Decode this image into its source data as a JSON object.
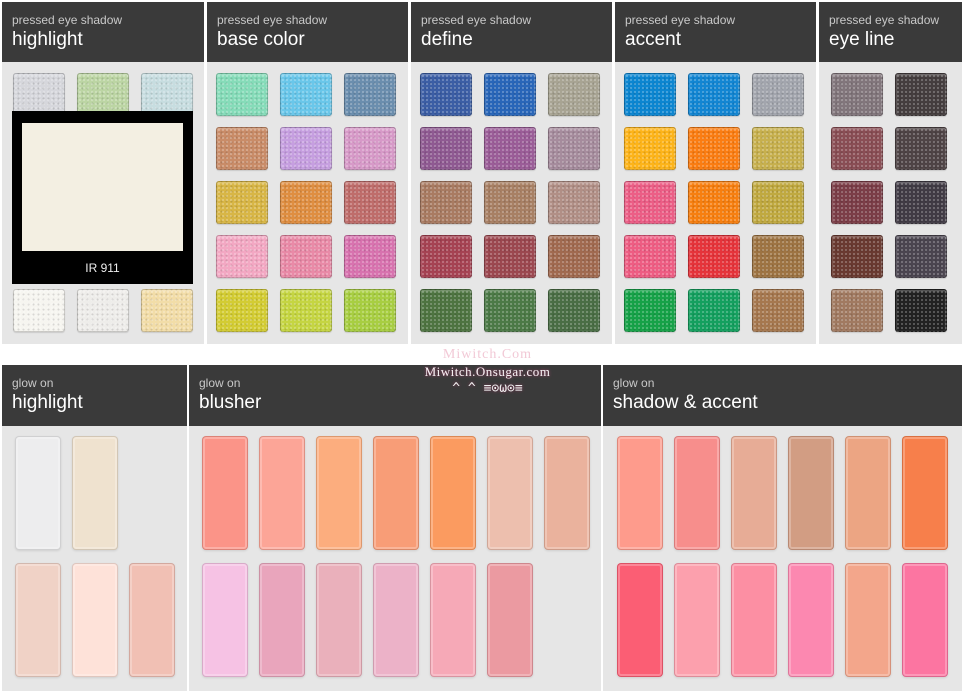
{
  "colors": {
    "header_bg": "#3a3a3a",
    "panel_bg": "#e6e6e6"
  },
  "panels": [
    {
      "sub": "pressed eye shadow",
      "title": "highlight"
    },
    {
      "sub": "pressed eye shadow",
      "title": "base color"
    },
    {
      "sub": "pressed eye shadow",
      "title": "define"
    },
    {
      "sub": "pressed eye shadow",
      "title": "accent"
    },
    {
      "sub": "pressed eye shadow",
      "title": "eye line"
    },
    {
      "sub": "glow on",
      "title": "highlight"
    },
    {
      "sub": "glow on",
      "title": "blusher"
    },
    {
      "sub": "glow on",
      "title": "shadow & accent"
    }
  ],
  "popup": {
    "label": "IR 911",
    "color": "#f3efe2"
  },
  "watermark": {
    "line1": "Miwitch.Com",
    "line2": "Miwitch.Onsugar.com",
    "line3": "^ ^ ≡⊙ω⊙≡"
  },
  "eye": {
    "highlight": [
      "#d6d7dc",
      "#bcd5a4",
      "#c7dde0",
      "#f6f5f0",
      "#eeedea",
      "#f2dda8"
    ],
    "base_color": [
      "#86dcb9",
      "#6ac7ea",
      "#6b8eae",
      "#c98c68",
      "#c69fe0",
      "#d79ac8",
      "#d8b646",
      "#df8e41",
      "#bf6d6b",
      "#f3a8c3",
      "#e98aa7",
      "#d873af",
      "#d3cc33",
      "#c5d542",
      "#a8ce42"
    ],
    "define": [
      "#3c5ea5",
      "#2966b9",
      "#a8a493",
      "#8f5a92",
      "#9b5d98",
      "#a68c9d",
      "#a97b62",
      "#a88064",
      "#b18f86",
      "#a64353",
      "#9c4850",
      "#a16a50",
      "#4e7441",
      "#4c7a47",
      "#4a6e45"
    ],
    "accent": [
      "#0c86d1",
      "#1286d3",
      "#a2a5ad",
      "#fdb41a",
      "#fb7d12",
      "#c7b04e",
      "#ec5e86",
      "#f77f10",
      "#c0a940",
      "#ee5d83",
      "#e6343b",
      "#9e7443",
      "#16a248",
      "#14a05f",
      "#a6784f"
    ],
    "eye_line": [
      "#82767c",
      "#453e3f",
      "#8a4e55",
      "#4f4446",
      "#7c3e48",
      "#413b45",
      "#6a3a31",
      "#4b4550",
      "#a17a61",
      "#222222"
    ]
  },
  "glow": {
    "highlight": [
      "#ededee",
      "#efe2cf",
      "#f0d2c6",
      "#fee2d9",
      "#f1c0b4"
    ],
    "blusher": [
      "#fb9488",
      "#fca597",
      "#fcad7e",
      "#f89d77",
      "#fb9b60",
      "#edbfae",
      "#eab29d",
      "#f6c2e4",
      "#e9a5bc",
      "#eab0bb",
      "#ecb2c8",
      "#f6a9b7",
      "#eb9aa1"
    ],
    "shadow_accent": [
      "#fe9b8c",
      "#f78e8c",
      "#e7ac96",
      "#d29d83",
      "#eca583",
      "#f77f4b",
      "#fb5e74",
      "#fca0ad",
      "#fc8fa3",
      "#fc88b0",
      "#f3a68b",
      "#fc75a1"
    ]
  }
}
